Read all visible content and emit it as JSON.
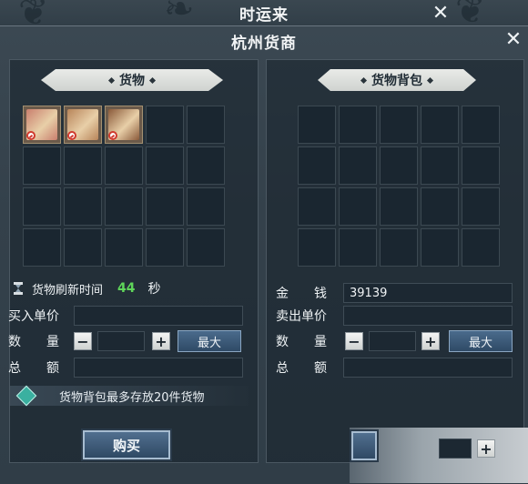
{
  "window": {
    "title": "时运来"
  },
  "dialog": {
    "title": "杭州货商"
  },
  "goods": {
    "header": "货物",
    "items": [
      {
        "icon": "cloth-bundle-icon",
        "color": "#c97f6e"
      },
      {
        "icon": "scroll-icon",
        "color": "#b8855a"
      },
      {
        "icon": "wooden-box-icon",
        "color": "#8a5a3a"
      }
    ],
    "slot_count": 20,
    "refresh_label": "货物刷新时间",
    "refresh_value": "44",
    "refresh_unit": "秒",
    "buy_price_label": "买入单价",
    "buy_price_value": "",
    "quantity_label": "数　　量",
    "quantity_value": "",
    "minus": "−",
    "plus": "+",
    "max_label": "最大",
    "total_label": "总　　额",
    "total_value": "",
    "notice": "货物背包最多存放20件货物",
    "buy_label": "购买"
  },
  "bag": {
    "header": "货物背包",
    "slot_count": 20,
    "money_label": "金　　钱",
    "money_value": "39139",
    "sell_price_label": "卖出单价",
    "sell_price_value": "",
    "quantity_label": "数　　量",
    "quantity_value": "",
    "minus": "−",
    "plus": "+",
    "max_label": "最大",
    "total_label": "总　　额",
    "total_value": "",
    "overlay_plus": "+"
  },
  "colors": {
    "accent": "#5fd65a",
    "ban": "#d03a2e"
  }
}
